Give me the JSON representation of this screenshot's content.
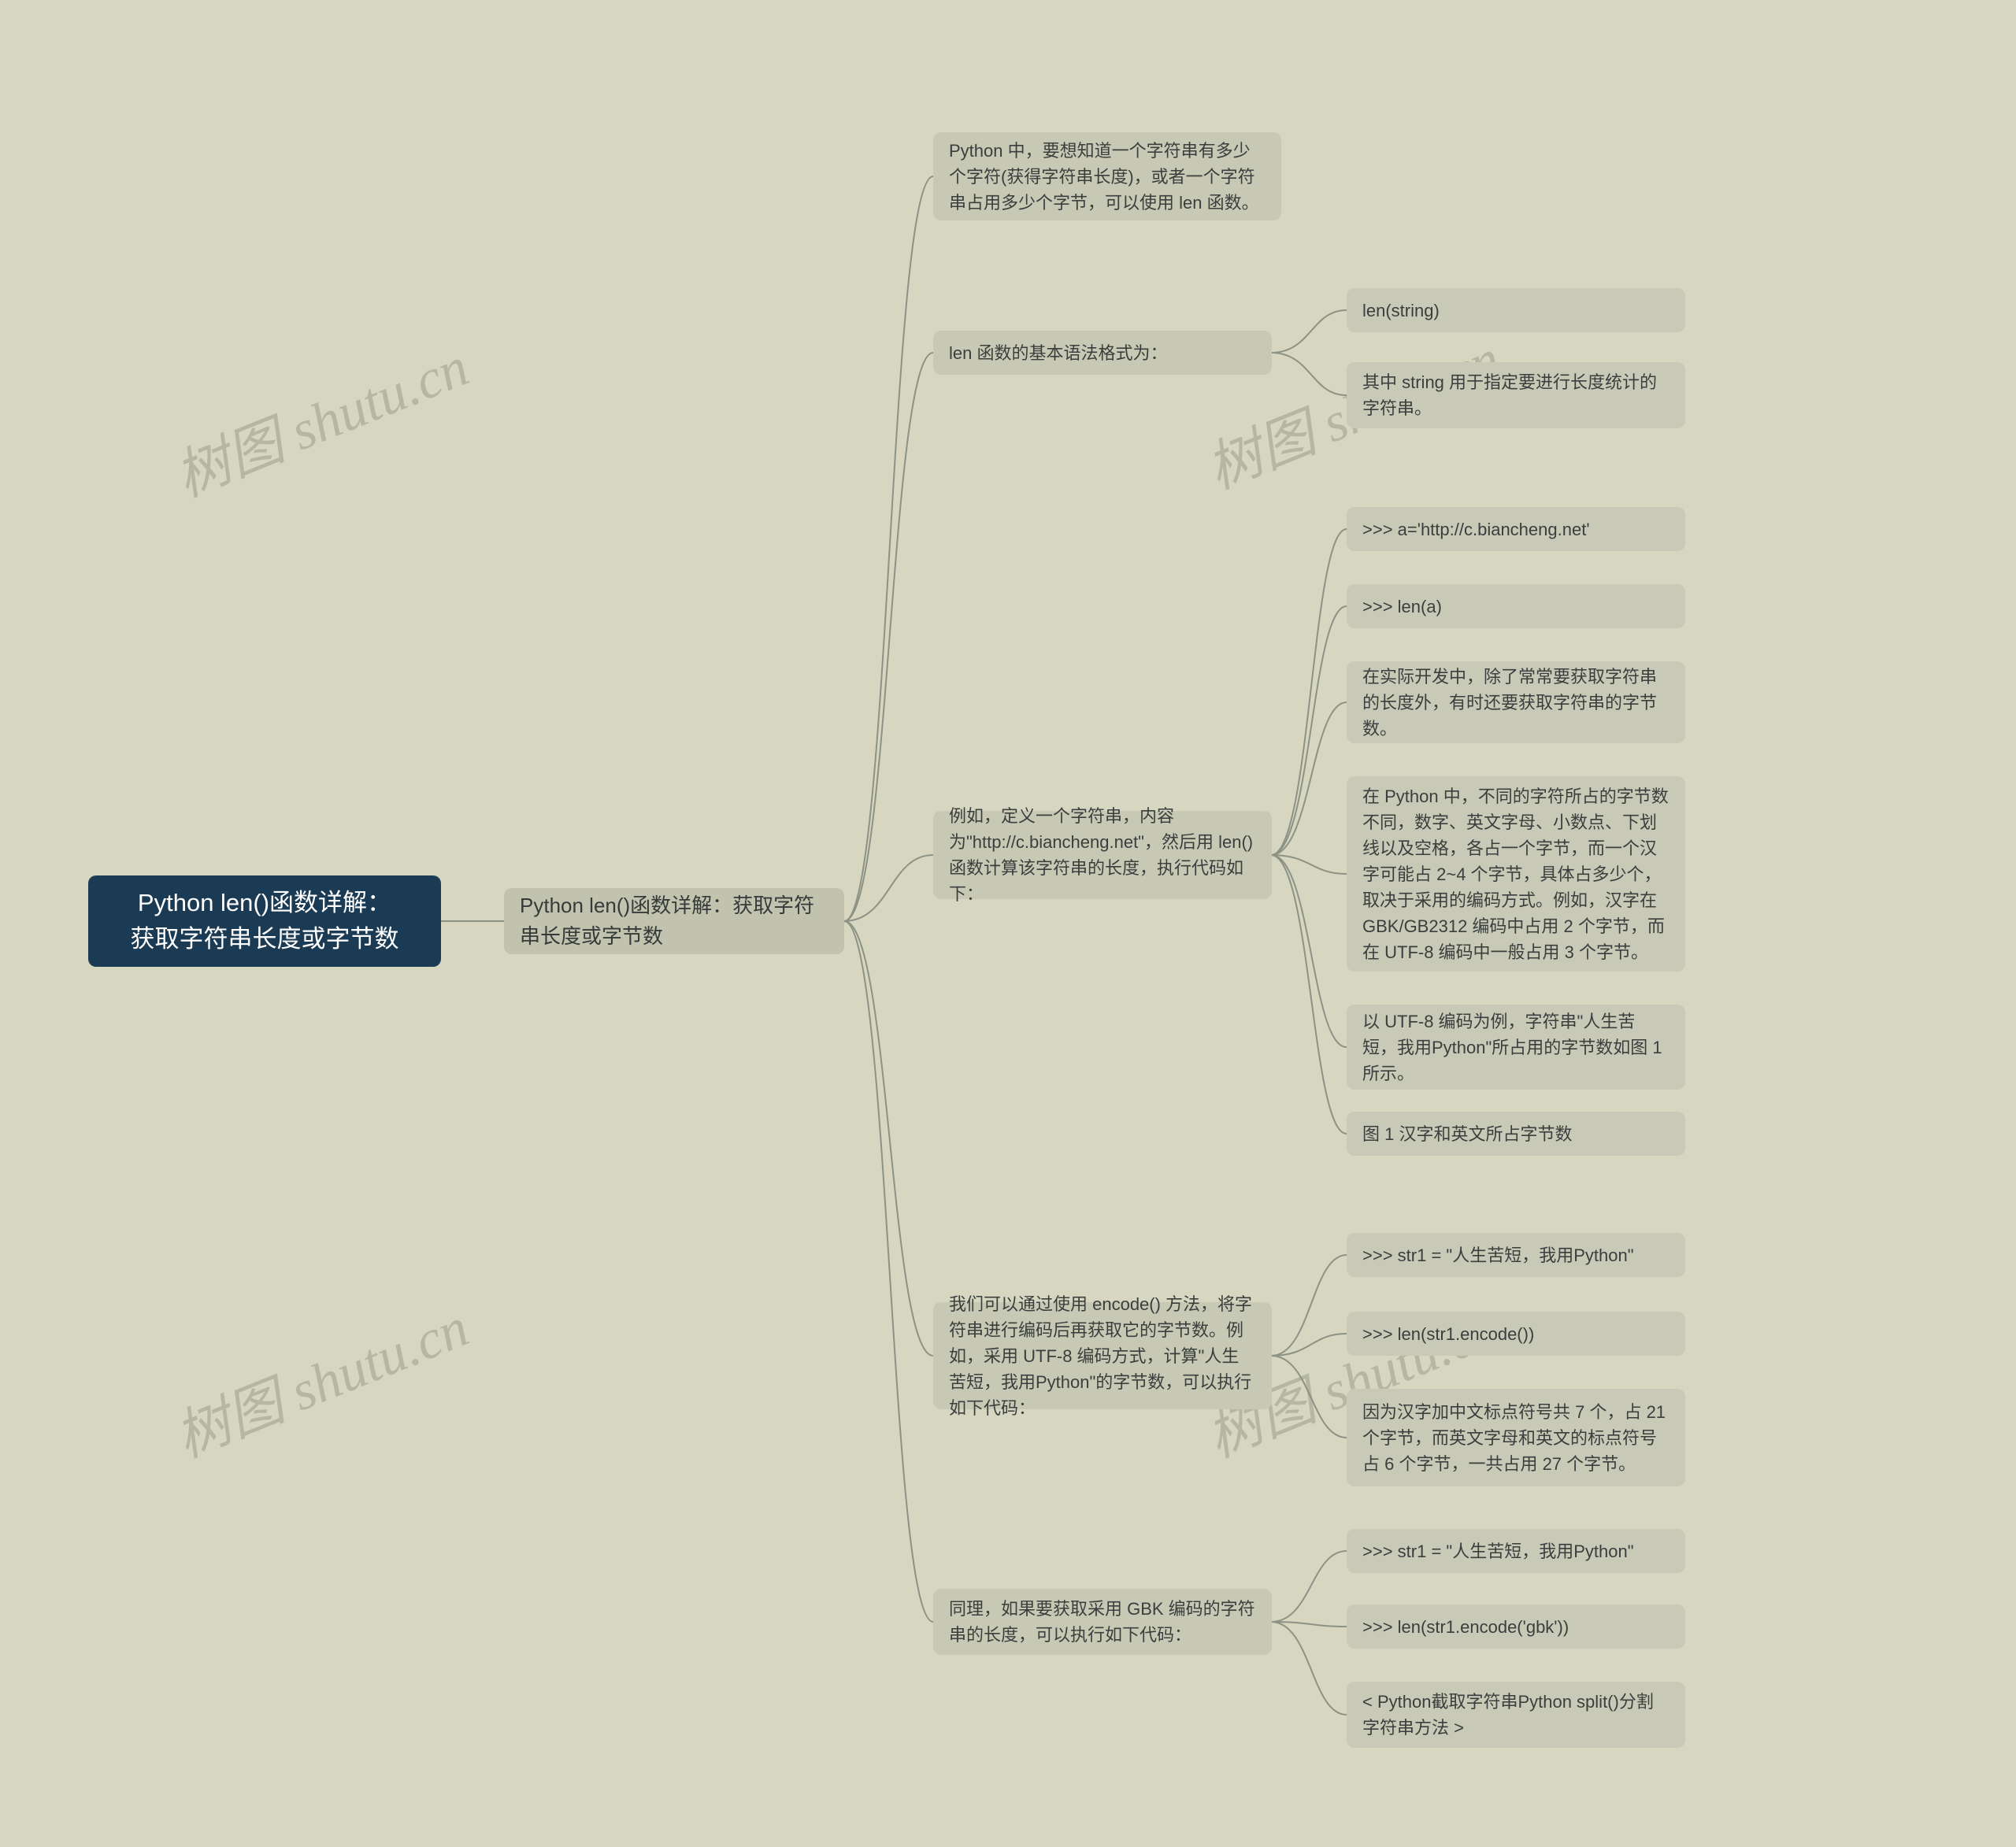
{
  "watermark": "树图 shutu.cn",
  "root": {
    "line1": "Python len()函数详解：",
    "line2": "获取字符串长度或字节数"
  },
  "level1": {
    "text": "Python len()函数详解：获取字符串长度或字节数"
  },
  "branches": [
    {
      "text": "Python 中，要想知道一个字符串有多少个字符(获得字符串长度)，或者一个字符串占用多少个字节，可以使用 len 函数。",
      "children": []
    },
    {
      "text": "len 函数的基本语法格式为：",
      "children": [
        {
          "text": "len(string)"
        },
        {
          "text": "其中 string 用于指定要进行长度统计的字符串。"
        }
      ]
    },
    {
      "text": "例如，定义一个字符串，内容为\"http://c.biancheng.net\"，然后用 len() 函数计算该字符串的长度，执行代码如下：",
      "children": [
        {
          "text": ">>> a='http://c.biancheng.net'"
        },
        {
          "text": ">>> len(a)"
        },
        {
          "text": "在实际开发中，除了常常要获取字符串的长度外，有时还要获取字符串的字节数。"
        },
        {
          "text": "在 Python 中，不同的字符所占的字节数不同，数字、英文字母、小数点、下划线以及空格，各占一个字节，而一个汉字可能占 2~4 个字节，具体占多少个，取决于采用的编码方式。例如，汉字在 GBK/GB2312 编码中占用 2 个字节，而在 UTF-8 编码中一般占用 3 个字节。"
        },
        {
          "text": "以 UTF-8 编码为例，字符串\"人生苦短，我用Python\"所占用的字节数如图 1 所示。"
        },
        {
          "text": "图 1 汉字和英文所占字节数"
        }
      ]
    },
    {
      "text": "我们可以通过使用 encode() 方法，将字符串进行编码后再获取它的字节数。例如，采用 UTF-8 编码方式，计算\"人生苦短，我用Python\"的字节数，可以执行如下代码：",
      "children": [
        {
          "text": ">>> str1 = \"人生苦短，我用Python\""
        },
        {
          "text": ">>> len(str1.encode())"
        },
        {
          "text": "因为汉字加中文标点符号共 7 个，占 21 个字节，而英文字母和英文的标点符号占 6 个字节，一共占用 27 个字节。"
        }
      ]
    },
    {
      "text": "同理，如果要获取采用 GBK 编码的字符串的长度，可以执行如下代码：",
      "children": [
        {
          "text": ">>> str1 = \"人生苦短，我用Python\""
        },
        {
          "text": ">>> len(str1.encode('gbk'))"
        },
        {
          "text": "< Python截取字符串Python split()分割字符串方法 >"
        }
      ]
    }
  ]
}
